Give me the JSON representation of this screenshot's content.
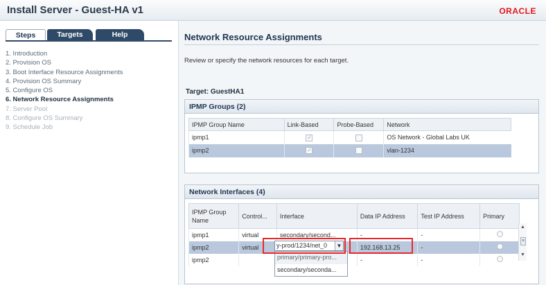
{
  "window": {
    "title": "Install Server - Guest-HA v1",
    "logo_text": "ORACLE"
  },
  "tabs": [
    {
      "label": "Steps"
    },
    {
      "label": "Targets"
    },
    {
      "label": "Help"
    }
  ],
  "steps": [
    {
      "label": "1.  Introduction"
    },
    {
      "label": "2.  Provision OS"
    },
    {
      "label": "3.  Boot Interface Resource Assignments"
    },
    {
      "label": "4.  Provision OS Summary"
    },
    {
      "label": "5.  Configure OS"
    },
    {
      "label": "6.  Network Resource Assignments"
    },
    {
      "label": "7.  Server Pool"
    },
    {
      "label": "8.  Configure OS Summary"
    },
    {
      "label": "9.  Schedule Job"
    }
  ],
  "main": {
    "heading": "Network Resource Assignments",
    "description": "Review or specify the network resources for each target.",
    "target_label": "Target: GuestHA1"
  },
  "ipmp": {
    "title": "IPMP Groups (2)",
    "columns": [
      "IPMP Group Name",
      "Link-Based",
      "Probe-Based",
      "Network"
    ],
    "rows": [
      {
        "name": "ipmp1",
        "network": "OS Network - Global Labs UK",
        "link_based": true,
        "probe_based": false
      },
      {
        "name": "ipmp2",
        "network": "vlan-1234",
        "link_based": true,
        "probe_based": false
      }
    ]
  },
  "nics": {
    "title": "Network Interfaces (4)",
    "columns": [
      "IPMP Group Name",
      "Control...",
      "Interface",
      "Data IP Address",
      "Test IP Address",
      "Primary"
    ],
    "rows": [
      {
        "group": "ipmp1",
        "control": "virtual",
        "interface": "secondary/second...",
        "data_ip": "-",
        "test_ip": "-"
      },
      {
        "group": "ipmp2",
        "control": "virtual",
        "interface": "y-prod/1234/net_0",
        "data_ip": "192.168.13.25",
        "test_ip": "-"
      },
      {
        "group": "ipmp2",
        "control": "",
        "interface": "",
        "data_ip": "-",
        "test_ip": "-"
      }
    ],
    "dropdown_options": [
      "primary/primary-pro...",
      "secondary/seconda..."
    ]
  },
  "colors": {
    "accent": "#2f4a68",
    "highlight_box": "#e8262b",
    "selected_row": "#b9c8dc",
    "oracle_red": "#e4141b"
  }
}
